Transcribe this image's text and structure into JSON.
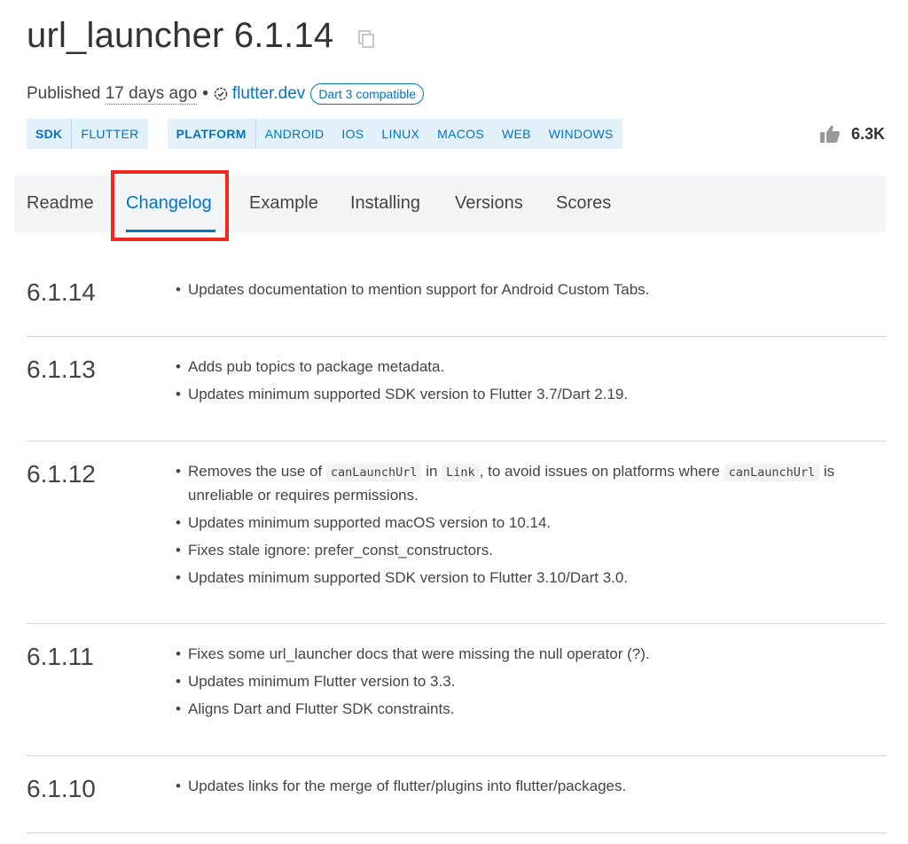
{
  "package": {
    "title": "url_launcher 6.1.14",
    "published_prefix": "Published",
    "published_ago": "17 days ago",
    "separator": "•",
    "publisher": "flutter.dev",
    "dart3_badge": "Dart 3 compatible"
  },
  "tags": {
    "sdk_label": "SDK",
    "sdk_values": [
      "FLUTTER"
    ],
    "platform_label": "PLATFORM",
    "platform_values": [
      "ANDROID",
      "IOS",
      "LINUX",
      "MACOS",
      "WEB",
      "WINDOWS"
    ]
  },
  "likes": "6.3K",
  "tabs": [
    {
      "label": "Readme",
      "active": false
    },
    {
      "label": "Changelog",
      "active": true
    },
    {
      "label": "Example",
      "active": false
    },
    {
      "label": "Installing",
      "active": false
    },
    {
      "label": "Versions",
      "active": false
    },
    {
      "label": "Scores",
      "active": false
    }
  ],
  "changelog": [
    {
      "version": "6.1.14",
      "items": [
        "Updates documentation to mention support for Android Custom Tabs."
      ]
    },
    {
      "version": "6.1.13",
      "items": [
        "Adds pub topics to package metadata.",
        "Updates minimum supported SDK version to Flutter 3.7/Dart 2.19."
      ]
    },
    {
      "version": "6.1.12",
      "items": [
        {
          "parts": [
            {
              "t": "Removes the use of "
            },
            {
              "code": "canLaunchUrl"
            },
            {
              "t": " in "
            },
            {
              "code": "Link"
            },
            {
              "t": ", to avoid issues on platforms where "
            },
            {
              "code": "canLaunchUrl"
            },
            {
              "t": " is unreliable or requires permissions."
            }
          ]
        },
        "Updates minimum supported macOS version to 10.14.",
        "Fixes stale ignore: prefer_const_constructors.",
        "Updates minimum supported SDK version to Flutter 3.10/Dart 3.0."
      ]
    },
    {
      "version": "6.1.11",
      "items": [
        "Fixes some url_launcher docs that were missing the null operator (?).",
        "Updates minimum Flutter version to 3.3.",
        "Aligns Dart and Flutter SDK constraints."
      ]
    },
    {
      "version": "6.1.10",
      "items": [
        "Updates links for the merge of flutter/plugins into flutter/packages."
      ]
    }
  ],
  "colors": {
    "accent": "#0175c2",
    "highlight": "#f3271c",
    "tag_bg": "#e3f1fa",
    "tabs_bg": "#f4f5f7"
  }
}
